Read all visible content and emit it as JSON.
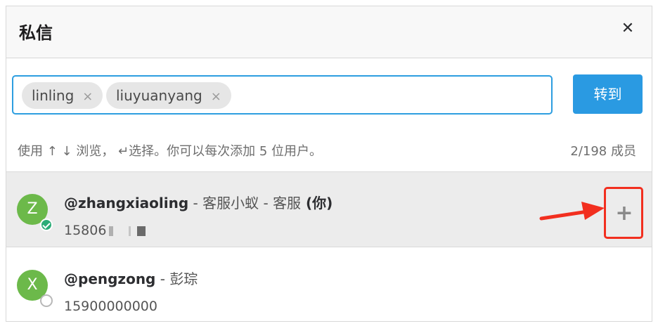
{
  "dialog": {
    "title": "私信",
    "close_glyph": "✕"
  },
  "picker": {
    "chips": [
      {
        "label": "linling",
        "remove_glyph": "×"
      },
      {
        "label": "liuyuanyang",
        "remove_glyph": "×"
      }
    ]
  },
  "goto_button": "转到",
  "hint": "使用 ↑ ↓ 浏览， ↵选择。你可以每次添加 5 位用户。",
  "member_count": "2/198 成员",
  "results": [
    {
      "avatar_letter": "Z",
      "avatar_color": "#6cb94a",
      "handle": "@zhangxiaoling",
      "separator1": " - ",
      "display_name": "客服小蚁",
      "separator2": " - ",
      "role": "客服",
      "you_tag": " (你)",
      "phone": "15806",
      "online": true,
      "add_glyph": "+"
    },
    {
      "avatar_letter": "X",
      "avatar_color": "#6cb94a",
      "handle": "@pengzong",
      "separator1": " - ",
      "display_name": "彭琮",
      "phone": "15900000000",
      "online": false
    }
  ],
  "colors": {
    "accent": "#2a9ae2",
    "annotation": "#f22f1f",
    "online_status": "#2bac76"
  }
}
